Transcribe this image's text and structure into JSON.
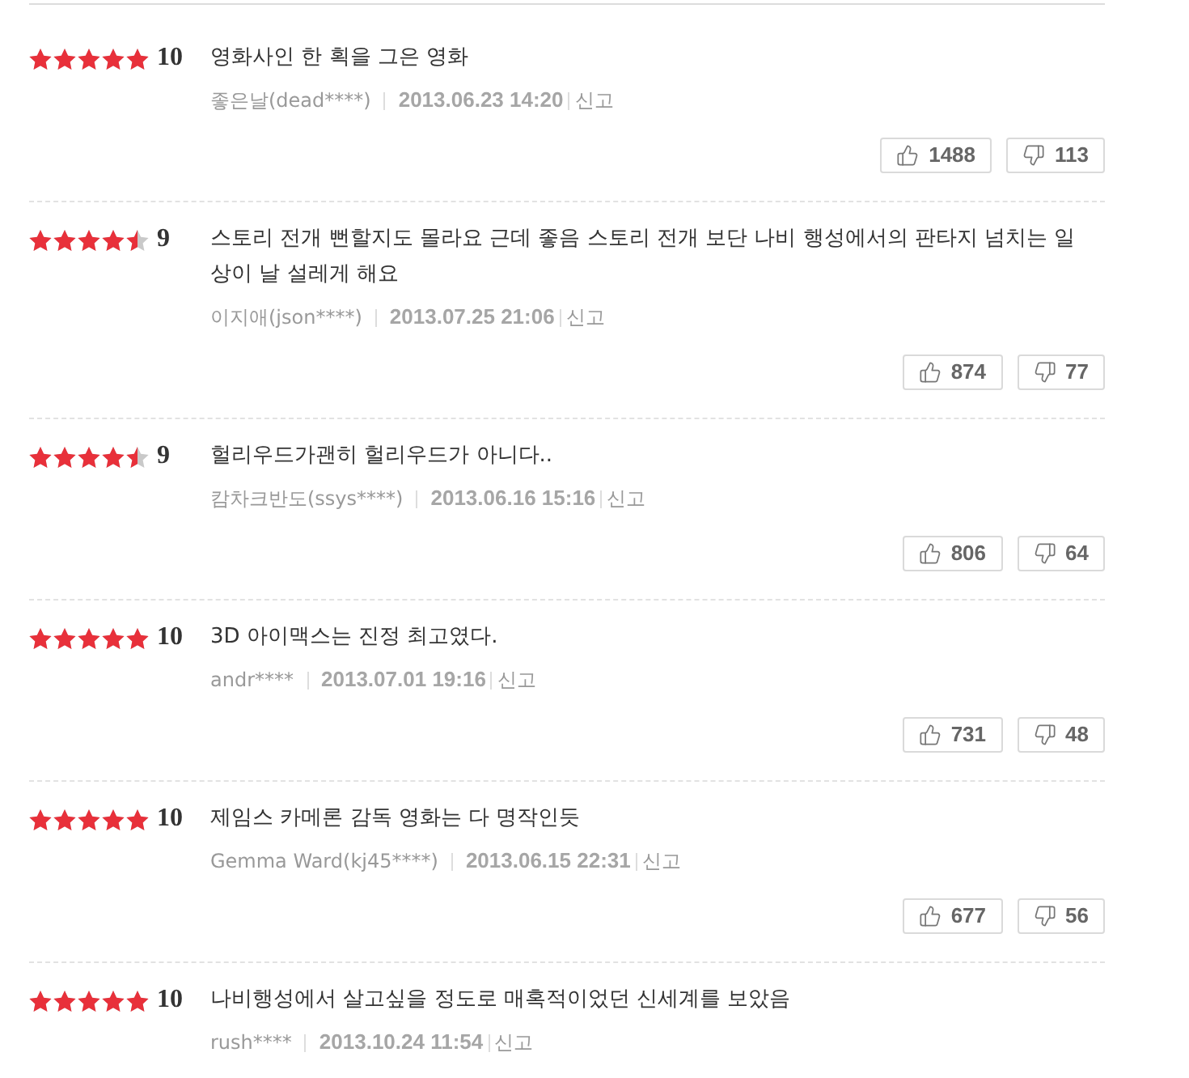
{
  "reviews": [
    {
      "stars": 5,
      "score": "10",
      "text": "영화사인 한 획을 그은 영화",
      "author": "좋은날(dead****)",
      "date": "2013.06.23 14:20",
      "report": "신고",
      "likes": "1488",
      "dislikes": "113"
    },
    {
      "stars": 4.5,
      "score": "9",
      "text": "스토리 전개 뻔할지도 몰라요 근데 좋음 스토리 전개 보단 나비 행성에서의 판타지 넘치는 일상이 날 설레게 해요",
      "author": "이지애(json****)",
      "date": "2013.07.25 21:06",
      "report": "신고",
      "likes": "874",
      "dislikes": "77"
    },
    {
      "stars": 4.5,
      "score": "9",
      "text": "헐리우드가괜히 헐리우드가 아니다..",
      "author": "캄차크반도(ssys****)",
      "date": "2013.06.16 15:16",
      "report": "신고",
      "likes": "806",
      "dislikes": "64"
    },
    {
      "stars": 5,
      "score": "10",
      "text": "3D 아이맥스는 진정 최고였다.",
      "author": "andr****",
      "date": "2013.07.01 19:16",
      "report": "신고",
      "likes": "731",
      "dislikes": "48"
    },
    {
      "stars": 5,
      "score": "10",
      "text": "제임스 카메론 감독 영화는 다 명작인듯",
      "author": "Gemma Ward(kj45****)",
      "date": "2013.06.15 22:31",
      "report": "신고",
      "likes": "677",
      "dislikes": "56"
    },
    {
      "stars": 5,
      "score": "10",
      "text": "나비행성에서 살고싶을 정도로 매혹적이었던 신세계를 보았음",
      "author": "rush****",
      "date": "2013.10.24 11:54",
      "report": "신고"
    }
  ]
}
